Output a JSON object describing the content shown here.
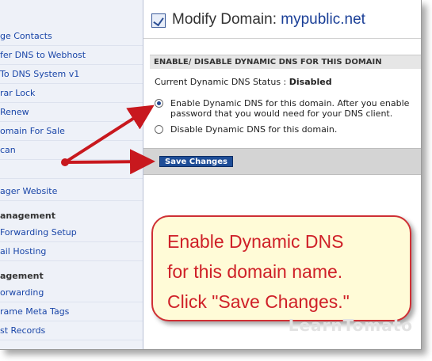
{
  "sidebar": {
    "items": [
      {
        "label": "ge Contacts"
      },
      {
        "label": "fer DNS to Webhost"
      },
      {
        "label": "To DNS System v1"
      },
      {
        "label": "rar Lock"
      },
      {
        "label": "Renew"
      },
      {
        "label": "omain For Sale"
      },
      {
        "label": "can"
      },
      {
        "label": ""
      },
      {
        "label": "ager Website"
      }
    ],
    "section1_heading": "anagement",
    "section1_items": [
      {
        "label": "Forwarding Setup"
      },
      {
        "label": "ail Hosting"
      }
    ],
    "section2_heading": "agement",
    "section2_items": [
      {
        "label": "orwarding"
      },
      {
        "label": "rame Meta Tags"
      },
      {
        "label": "st Records"
      }
    ]
  },
  "main": {
    "title_prefix": "Modify Domain: ",
    "domain": "mypublic.net",
    "section_header": "ENABLE/ DISABLE DYNAMIC DNS FOR THIS DOMAIN",
    "status_label": "Current Dynamic DNS Status : ",
    "status_value": "Disabled",
    "option_enable_line1": "Enable Dynamic DNS for this domain. After you enable",
    "option_enable_line2": "password that you would need for your DNS client.",
    "option_disable": "Disable Dynamic DNS for this domain.",
    "save_label": "Save Changes",
    "selected_option": "enable"
  },
  "callout": {
    "line1": "Enable Dynamic DNS",
    "line2": "for this domain name.",
    "line3": "Click \"Save Changes.\""
  },
  "watermark": "LearnTomato",
  "colors": {
    "arrow": "#c8181e",
    "link": "#1a46a8",
    "button": "#1e4d97",
    "callout_border": "#cf3034",
    "callout_bg": "#fffbd7"
  }
}
